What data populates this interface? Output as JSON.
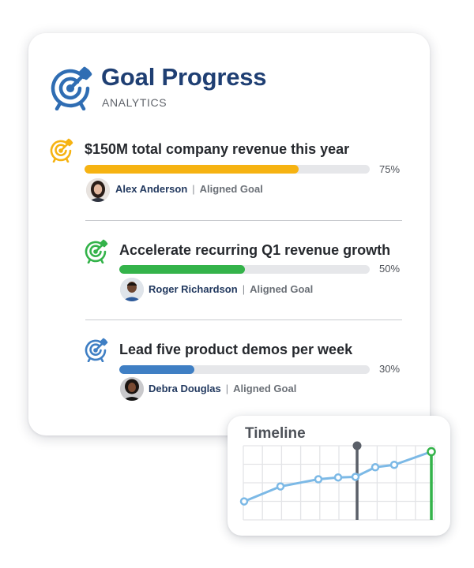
{
  "app": {
    "title": "Goal Progress",
    "subtitle": "ANALYTICS",
    "icon": "target-icon"
  },
  "goals": [
    {
      "title": "$150M total company revenue this year",
      "progress_percent": 75,
      "progress_label": "75%",
      "owner": "Alex Anderson",
      "separator": "|",
      "type": "Aligned Goal",
      "color": "#f6b312",
      "icon": "target-icon"
    },
    {
      "title": "Accelerate recurring Q1 revenue growth",
      "progress_percent": 50,
      "progress_label": "50%",
      "owner": "Roger Richardson",
      "separator": "|",
      "type": "Aligned Goal",
      "color": "#34b34a",
      "icon": "target-icon"
    },
    {
      "title": "Lead five product demos per week",
      "progress_percent": 30,
      "progress_label": "30%",
      "owner": "Debra Douglas",
      "separator": "|",
      "type": "Aligned Goal",
      "color": "#3f7fc4",
      "icon": "target-icon"
    }
  ],
  "timeline": {
    "title": "Timeline",
    "line_color": "#7cb9e6",
    "marker_color": "#5b6069",
    "goal_marker_color": "#34b34a",
    "points": [
      0.15,
      0.4,
      0.52,
      0.55,
      0.56,
      0.72,
      0.76,
      0.98
    ]
  },
  "colors": {
    "brand": "#1f3f73",
    "track": "#e6e7ea"
  }
}
